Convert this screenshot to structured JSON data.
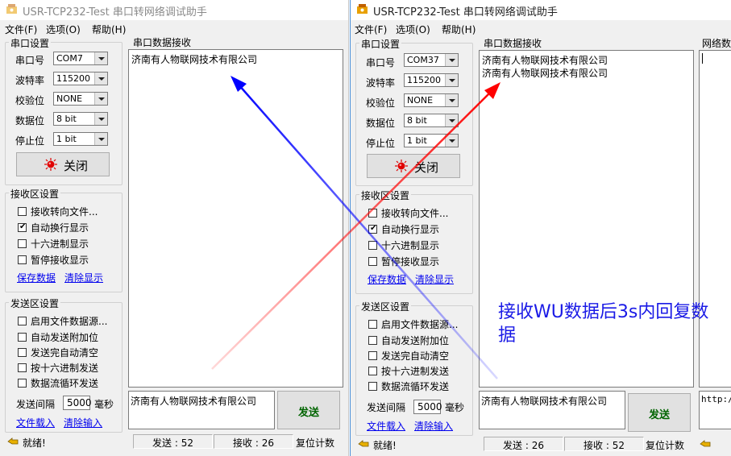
{
  "window1": {
    "title": "USR-TCP232-Test 串口转网络调试助手",
    "menu": [
      "文件(F)",
      "选项(O)",
      "帮助(H)"
    ],
    "serial_settings": {
      "title": "串口设置",
      "port_label": "串口号",
      "port_value": "COM7",
      "baud_label": "波特率",
      "baud_value": "115200",
      "parity_label": "校验位",
      "parity_value": "NONE",
      "databits_label": "数据位",
      "databits_value": "8 bit",
      "stopbits_label": "停止位",
      "stopbits_value": "1 bit",
      "close_button": "关闭"
    },
    "recv_settings": {
      "title": "接收区设置",
      "options": [
        {
          "label": "接收转向文件...",
          "checked": false
        },
        {
          "label": "自动换行显示",
          "checked": true
        },
        {
          "label": "十六进制显示",
          "checked": false
        },
        {
          "label": "暂停接收显示",
          "checked": false
        }
      ],
      "save_link": "保存数据",
      "clear_link": "清除显示"
    },
    "send_settings": {
      "title": "发送区设置",
      "options": [
        {
          "label": "启用文件数据源...",
          "checked": false
        },
        {
          "label": "自动发送附加位",
          "checked": false
        },
        {
          "label": "发送完自动清空",
          "checked": false
        },
        {
          "label": "按十六进制发送",
          "checked": false
        },
        {
          "label": "数据流循环发送",
          "checked": false
        }
      ],
      "interval_label": "发送间隔",
      "interval_value": "5000",
      "interval_unit": "毫秒",
      "file_link": "文件载入",
      "clear_input_link": "清除输入"
    },
    "recv_area": {
      "title": "串口数据接收",
      "lines": [
        "济南有人物联网技术有限公司"
      ]
    },
    "send_area": {
      "text": "济南有人物联网技术有限公司",
      "send_button": "发送"
    },
    "status": {
      "ready": "就绪!",
      "sent": "发送 : 52",
      "received": "接收 : 26",
      "reset": "复位计数"
    }
  },
  "window2": {
    "title": "USR-TCP232-Test 串口转网络调试助手",
    "menu": [
      "文件(F)",
      "选项(O)",
      "帮助(H)"
    ],
    "serial_settings": {
      "title": "串口设置",
      "port_label": "串口号",
      "port_value": "COM37",
      "baud_label": "波特率",
      "baud_value": "115200",
      "parity_label": "校验位",
      "parity_value": "NONE",
      "databits_label": "数据位",
      "databits_value": "8 bit",
      "stopbits_label": "停止位",
      "stopbits_value": "1 bit",
      "close_button": "关闭"
    },
    "recv_settings": {
      "title": "接收区设置",
      "options": [
        {
          "label": "接收转向文件...",
          "checked": false
        },
        {
          "label": "自动换行显示",
          "checked": true
        },
        {
          "label": "十六进制显示",
          "checked": false
        },
        {
          "label": "暂停接收显示",
          "checked": false
        }
      ],
      "save_link": "保存数据",
      "clear_link": "清除显示"
    },
    "send_settings": {
      "title": "发送区设置",
      "options": [
        {
          "label": "启用文件数据源...",
          "checked": false
        },
        {
          "label": "自动发送附加位",
          "checked": false
        },
        {
          "label": "发送完自动清空",
          "checked": false
        },
        {
          "label": "按十六进制发送",
          "checked": false
        },
        {
          "label": "数据流循环发送",
          "checked": false
        }
      ],
      "interval_label": "发送间隔",
      "interval_value": "5000",
      "interval_unit": "毫秒",
      "file_link": "文件载入",
      "clear_input_link": "清除输入"
    },
    "recv_area": {
      "title": "串口数据接收",
      "lines": [
        "济南有人物联网技术有限公司",
        "济南有人物联网技术有限公司"
      ]
    },
    "net_area": {
      "title": "网络数",
      "send_text": "http:/"
    },
    "send_area": {
      "text": "济南有人物联网技术有限公司",
      "send_button": "发送"
    },
    "status": {
      "ready": "就绪!",
      "sent": "发送 : 26",
      "received": "接收 : 52",
      "reset": "复位计数"
    }
  },
  "annotation": {
    "text": "接收WU数据后3s内回复数据",
    "color": "#1a1ae6"
  },
  "colors": {
    "blue_arrow": "#0000ff",
    "red_arrow": "#ff0000",
    "send_label": "#006400",
    "link": "#0000ee"
  }
}
